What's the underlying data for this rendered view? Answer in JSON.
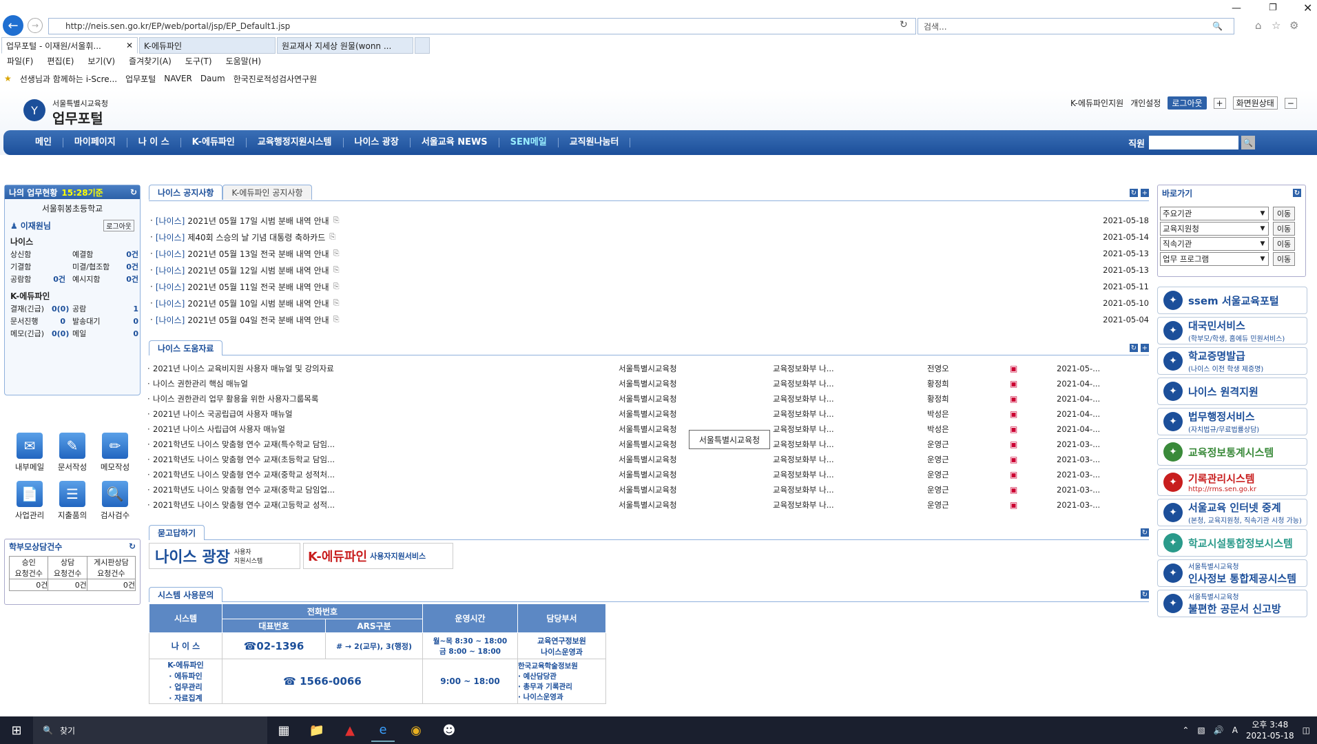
{
  "browser": {
    "address": "http://neis.sen.go.kr/EP/web/portal/jsp/EP_Default1.jsp",
    "search_placeholder": "검색...",
    "tabs": [
      "업무포털 - 이재원/서울휘...",
      "K-에듀파인",
      "원교재사 지세상 원물(wonn ..."
    ],
    "menu": [
      "파일(F)",
      "편집(E)",
      "보기(V)",
      "즐겨찾기(A)",
      "도구(T)",
      "도움말(H)"
    ],
    "favorites": [
      "선생님과 함께하는 i-Scre...",
      "업무포털",
      "NAVER",
      "Daum",
      "한국진로적성검사연구원"
    ]
  },
  "header": {
    "org": "서울특별시교육청",
    "title": "업무포털",
    "links": [
      "K-에듀파인지원",
      "개인설정"
    ],
    "logout": "로그아웃",
    "screen_state": "화면원상태"
  },
  "gnb": {
    "items": [
      "메인",
      "마이페이지",
      "나 이 스",
      "K-에듀파인",
      "교육행정지원시스템",
      "나이스 광장",
      "서울교육 NEWS",
      "SEN메일",
      "교직원나눔터"
    ],
    "search_label": "직원"
  },
  "left": {
    "title": "나의 업무현황",
    "time": "15:28기준",
    "school": "서울휘봉초등학교",
    "user": "이재원님",
    "logout": "로그아웃",
    "neis_title": "나이스",
    "neis_rows": [
      [
        "상신함",
        "",
        "예결함",
        "0건"
      ],
      [
        "기결함",
        "",
        "미결/협조함",
        "0건"
      ],
      [
        "공람함",
        "0건",
        "예시지함",
        "0건"
      ]
    ],
    "edufine_title": "K-에듀파인",
    "edufine_rows": [
      [
        "결재(긴급)",
        "0(0)",
        "공람",
        "1"
      ],
      [
        "문서진행",
        "0",
        "발송대기",
        "0"
      ],
      [
        "메모(긴급)",
        "0(0)",
        "메일",
        "0"
      ]
    ],
    "apps": [
      "내부메일",
      "문서작성",
      "메모작성",
      "사업관리",
      "지출품의",
      "검사검수"
    ],
    "parent_title": "학부모상담건수",
    "parent_headers": [
      "승인\n요청건수",
      "상담\n요청건수",
      "게시판상담\n요청건수"
    ],
    "parent_values": [
      "0건",
      "0건",
      "0건"
    ]
  },
  "notice": {
    "tabs": [
      "나이스 공지사항",
      "K-에듀파인 공지사항"
    ],
    "rows": [
      {
        "cat": "[나이스]",
        "title": "2021년 05월 17일 시범 분배 내역 안내",
        "date": "2021-05-18"
      },
      {
        "cat": "[나이스]",
        "title": "제40회 스승의 날 기념 대통령 축하카드",
        "date": "2021-05-14"
      },
      {
        "cat": "[나이스]",
        "title": "2021년 05월 13일 전국 분배 내역 안내",
        "date": "2021-05-13"
      },
      {
        "cat": "[나이스]",
        "title": "2021년 05월 12일 시범 분배 내역 안내",
        "date": "2021-05-13"
      },
      {
        "cat": "[나이스]",
        "title": "2021년 05월 11일 전국 분배 내역 안내",
        "date": "2021-05-11"
      },
      {
        "cat": "[나이스]",
        "title": "2021년 05월 10일 시범 분배 내역 안내",
        "date": "2021-05-10"
      },
      {
        "cat": "[나이스]",
        "title": "2021년 05월 04일 전국 분배 내역 안내",
        "date": "2021-05-04"
      }
    ]
  },
  "help": {
    "tab": "나이스 도움자료",
    "tooltip": "서울특별시교육청",
    "rows": [
      {
        "title": "2021년 나이스 교육비지원 사용자 매뉴얼 및 강의자료",
        "org": "서울특별시교육청",
        "dept": "교육정보화부 나...",
        "person": "전영오",
        "date": "2021-05-..."
      },
      {
        "title": "나이스 권한관리 핵심 매뉴얼",
        "org": "서울특별시교육청",
        "dept": "교육정보화부 나...",
        "person": "황정희",
        "date": "2021-04-..."
      },
      {
        "title": "나이스 권한관리 업무 활용을 위한 사용자그룹목록",
        "org": "서울특별시교육청",
        "dept": "교육정보화부 나...",
        "person": "황정희",
        "date": "2021-04-..."
      },
      {
        "title": "2021년 나이스 국공립급여 사용자 매뉴얼",
        "org": "서울특별시교육청",
        "dept": "교육정보화부 나...",
        "person": "박성은",
        "date": "2021-04-..."
      },
      {
        "title": "2021년 나이스 사립급여 사용자 매뉴얼",
        "org": "서울특별시교육청",
        "dept": "교육정보화부 나...",
        "person": "박성은",
        "date": "2021-04-..."
      },
      {
        "title": "2021학년도 나이스 맞춤형 연수 교재(특수학교 담임...",
        "org": "서울특별시교육청",
        "dept": "교육정보화부 나...",
        "person": "운영근",
        "date": "2021-03-..."
      },
      {
        "title": "2021학년도 나이스 맞춤형 연수 교재(초등학교 담임...",
        "org": "서울특별시교육청",
        "dept": "교육정보화부 나...",
        "person": "운영근",
        "date": "2021-03-..."
      },
      {
        "title": "2021학년도 나이스 맞춤형 연수 교재(중학교 성적처...",
        "org": "서울특별시교육청",
        "dept": "교육정보화부 나...",
        "person": "운영근",
        "date": "2021-03-..."
      },
      {
        "title": "2021학년도 나이스 맞춤형 연수 교재(중학교 담임업...",
        "org": "서울특별시교육청",
        "dept": "교육정보화부 나...",
        "person": "운영근",
        "date": "2021-03-..."
      },
      {
        "title": "2021학년도 나이스 맞춤형 연수 교재(고등학교 성적...",
        "org": "서울특별시교육청",
        "dept": "교육정보화부 나...",
        "person": "운영근",
        "date": "2021-03-..."
      }
    ]
  },
  "qna": {
    "tab": "묻고답하기",
    "banner1": "나이스 광장",
    "banner1_sub": "사용자\n지원시스템",
    "banner2": "K-에듀파인",
    "banner2_sub": "사용자지원서비스"
  },
  "system": {
    "tab": "시스템 사용문의",
    "headers": {
      "system": "시스템",
      "phone": "전화번호",
      "main": "대표번호",
      "ars": "ARS구분",
      "hours": "운영시간",
      "dept": "담당부서"
    },
    "row1": {
      "system": "나 이 스",
      "main": "☎02-1396",
      "ars": "# → 2(교무), 3(행정)",
      "hours": "월~목 8:30 ~ 18:00\n금 8:00 ~ 18:00",
      "dept": "교육연구정보원\n나이스운영과"
    },
    "row2": {
      "system": "K-에듀파인\n· 에듀파인\n· 업무관리\n· 자료집계",
      "main": "☎ 1566-0066",
      "hours": "9:00 ~ 18:00",
      "dept": "한국교육학술정보원\n· 예산담당관\n· 총무과 기록관리\n· 나이스운영과"
    }
  },
  "right": {
    "title": "바로가기",
    "selects": [
      "주요기관",
      "교육지원청",
      "직속기관",
      "업무 프로그램"
    ],
    "go": "이동",
    "banners": [
      {
        "name": "ssem 서울교육포털",
        "sub": ""
      },
      {
        "name": "대국민서비스",
        "sub": "(학부모/학생, 홈에듀 민원서비스)"
      },
      {
        "name": "학교증명발급",
        "sub": "(나이스 이전 학생 제증명)"
      },
      {
        "name": "나이스 원격지원",
        "sub": ""
      },
      {
        "name": "법무행정서비스",
        "sub": "(자치법규/무료법률상담)"
      },
      {
        "name": "교육정보통계시스템",
        "sub": ""
      },
      {
        "name": "기록관리시스템",
        "sub": "http://rms.sen.go.kr"
      },
      {
        "name": "서울교육 인터넷 중계",
        "sub": "(본청, 교육지원청, 직속기관 시청 가능)"
      },
      {
        "name": "학교시설통합정보시스템",
        "sub": ""
      },
      {
        "name": "인사정보 통합제공시스템",
        "sub": "서울특별시교육청"
      },
      {
        "name": "불편한 공문서 신고방",
        "sub": "서울특별시교육청"
      }
    ]
  },
  "taskbar": {
    "search": "찾기",
    "time": "오후 3:48",
    "date": "2021-05-18",
    "lang": "A"
  }
}
